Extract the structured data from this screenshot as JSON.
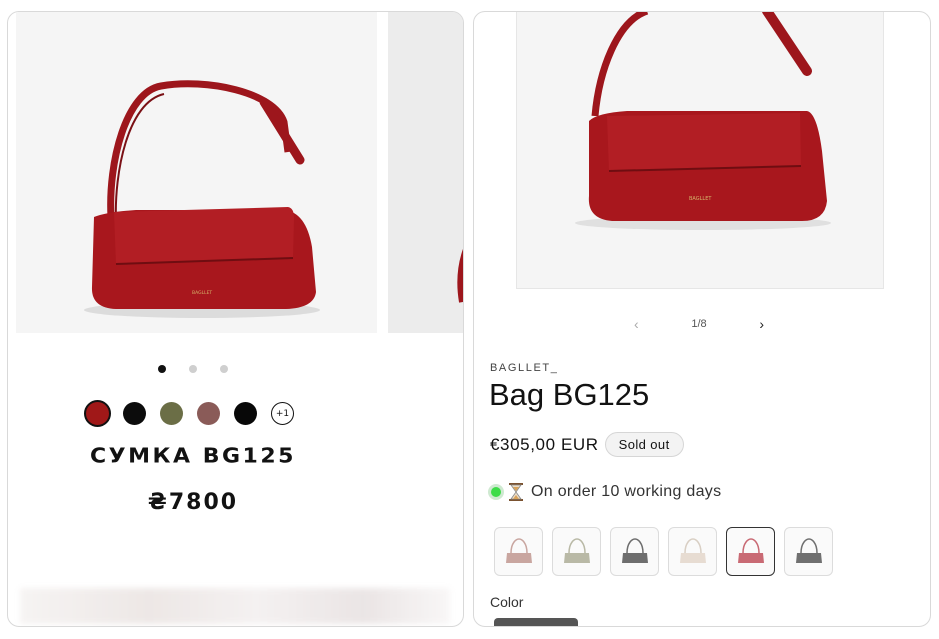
{
  "left_card": {
    "colors": [
      {
        "name": "red",
        "hex": "#a01818",
        "selected": true
      },
      {
        "name": "black",
        "hex": "#0c0c0c",
        "selected": false
      },
      {
        "name": "olive",
        "hex": "#6b6e46",
        "selected": false
      },
      {
        "name": "mauve",
        "hex": "#8a5b58",
        "selected": false
      },
      {
        "name": "black-2",
        "hex": "#080808",
        "selected": false
      }
    ],
    "more_colors": "+1",
    "title": "СУМКА BG125",
    "price": "₴7800",
    "carousel_dots": 3,
    "active_dot": 0
  },
  "right_card": {
    "slider_counter": "1/8",
    "vendor": "BAGLLET_",
    "title": "Bag BG125",
    "price": "€305,00 EUR",
    "badge": "Sold out",
    "stock_text": "On order 10 working days",
    "thumbnails": [
      {
        "name": "dusty-pink",
        "hex": "#c9a6a0",
        "selected": false
      },
      {
        "name": "sage",
        "hex": "#b9b9a6",
        "selected": false
      },
      {
        "name": "grey",
        "hex": "#6e6e6e",
        "selected": false
      },
      {
        "name": "cream",
        "hex": "#e7dcd2",
        "selected": false
      },
      {
        "name": "red",
        "hex": "#c96a74",
        "selected": true
      },
      {
        "name": "dark-grey",
        "hex": "#707070",
        "selected": false
      }
    ],
    "color_label": "Color"
  },
  "icons": {
    "prev": "chevron-left-icon",
    "next": "chevron-right-icon",
    "stock": "hourglass-icon"
  },
  "accent_colors": {
    "product_red": "#a51a1f",
    "stock_green": "#3ddc49"
  }
}
